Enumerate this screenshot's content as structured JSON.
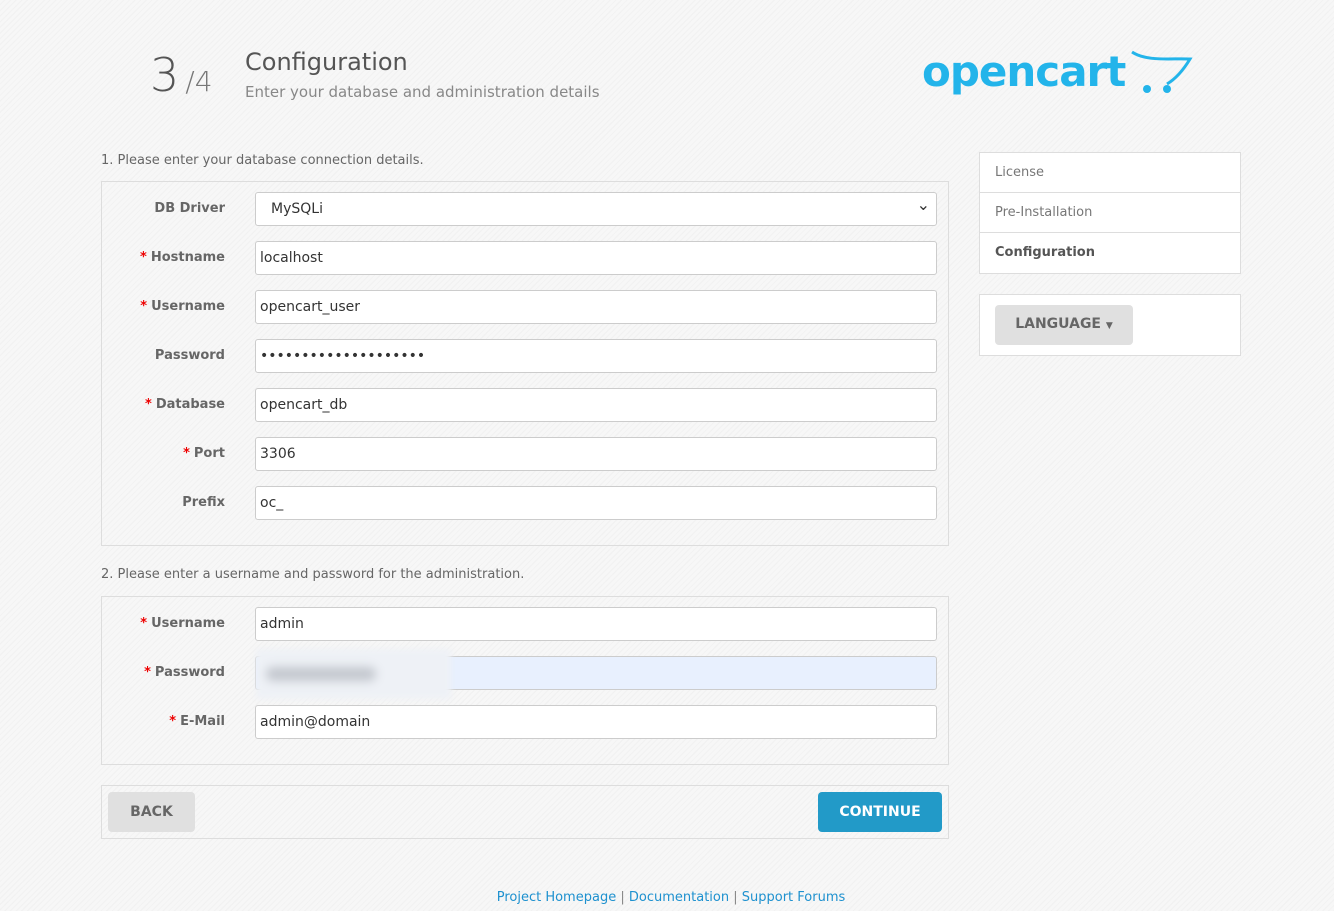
{
  "header": {
    "step": "3",
    "total": "/4",
    "title": "Configuration",
    "subtitle": "Enter your database and administration details",
    "logo_text": "opencart"
  },
  "db": {
    "heading": "1. Please enter your database connection details.",
    "fields": [
      {
        "label": "DB Driver",
        "required": false,
        "value": "MySQLi"
      },
      {
        "label": "Hostname",
        "required": true,
        "value": "localhost"
      },
      {
        "label": "Username",
        "required": true,
        "value": "opencart_user"
      },
      {
        "label": "Password",
        "required": false,
        "value": "••••••••••••••••••••"
      },
      {
        "label": "Database",
        "required": true,
        "value": "opencart_db"
      },
      {
        "label": "Port",
        "required": true,
        "value": "3306"
      },
      {
        "label": "Prefix",
        "required": false,
        "value": "oc_"
      }
    ]
  },
  "admin": {
    "heading": "2. Please enter a username and password for the administration.",
    "fields": [
      {
        "label": "Username",
        "required": true,
        "value": "admin"
      },
      {
        "label": "Password",
        "required": true,
        "value": ""
      },
      {
        "label": "E-Mail",
        "required": true,
        "value": "admin@domain"
      }
    ]
  },
  "buttons": {
    "back": "BACK",
    "continue": "CONTINUE"
  },
  "sidebar": {
    "steps": [
      "License",
      "Pre-Installation",
      "Configuration"
    ],
    "active": "Configuration",
    "language": "LANGUAGE"
  },
  "footer": {
    "links": [
      "Project Homepage",
      "Documentation",
      "Support Forums"
    ],
    "sep": "|"
  },
  "colors": {
    "brand": "#23b4ea",
    "primary_button": "#229ac8",
    "link": "#1e91cf"
  }
}
